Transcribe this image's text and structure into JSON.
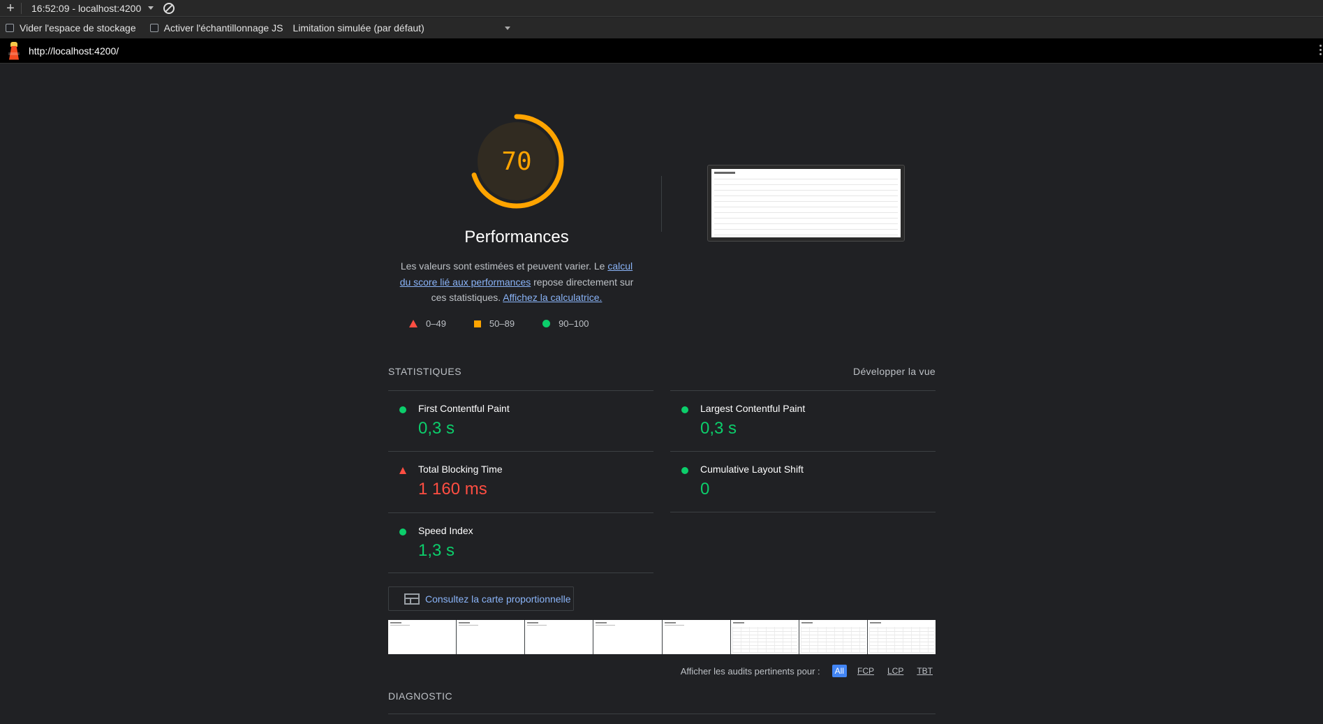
{
  "toolbar": {
    "plus_icon": "plus-icon",
    "report_label": "16:52:09 - localhost:4200",
    "clear_icon": "block-icon"
  },
  "options": {
    "clear_storage": "Vider l'espace de stockage",
    "js_sampling": "Activer l'échantillonnage JS",
    "throttling": "Limitation simulée (par défaut)"
  },
  "urlbar": {
    "url": "http://localhost:4200/"
  },
  "score": {
    "value": 70,
    "value_text": "70",
    "title": "Performances",
    "color": "#ffa400",
    "desc_part1": "Les valeurs sont estimées et peuvent varier. Le ",
    "desc_link1": "calcul du score lié aux performances",
    "desc_part2": " repose directement sur ces statistiques. ",
    "desc_link2": "Affichez la calculatrice."
  },
  "legend": {
    "fail": "0–49",
    "average": "50–89",
    "pass": "90–100"
  },
  "metrics": {
    "heading": "STATISTIQUES",
    "toggle": "Développer la vue",
    "items": [
      {
        "label": "First Contentful Paint",
        "value": "0,3 s",
        "status": "pass"
      },
      {
        "label": "Largest Contentful Paint",
        "value": "0,3 s",
        "status": "pass"
      },
      {
        "label": "Total Blocking Time",
        "value": "1 160 ms",
        "status": "fail"
      },
      {
        "label": "Cumulative Layout Shift",
        "value": "0",
        "status": "pass"
      },
      {
        "label": "Speed Index",
        "value": "1,3 s",
        "status": "pass"
      }
    ]
  },
  "treemap": {
    "label": "Consultez la carte proportionnelle"
  },
  "filter": {
    "label": "Afficher les audits pertinents pour :",
    "all": "All",
    "fcp": "FCP",
    "lcp": "LCP",
    "tbt": "TBT"
  },
  "diagnostic": {
    "heading": "DIAGNOSTIC"
  },
  "colors": {
    "pass": "#0cce6b",
    "average": "#ffa400",
    "fail": "#ff4e42",
    "link": "#8ab4f8",
    "background": "#202124"
  }
}
